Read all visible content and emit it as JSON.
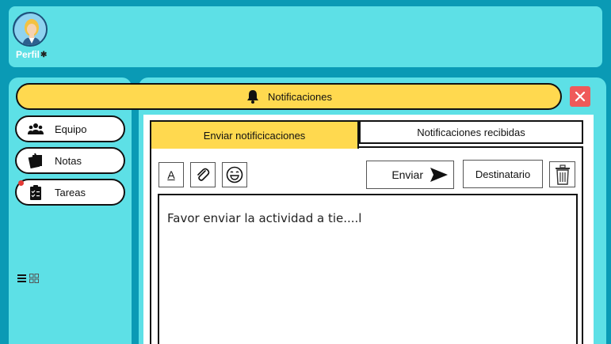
{
  "profile": {
    "label": "Perfil",
    "icon": "gear-icon"
  },
  "notification_bar": {
    "label": "Notificaciones",
    "icon": "bell-icon"
  },
  "sidebar": {
    "items": [
      {
        "label": "Equipo",
        "icon": "team-icon"
      },
      {
        "label": "Notas",
        "icon": "notes-icon"
      },
      {
        "label": "Tareas",
        "icon": "tasks-icon",
        "badge": true
      }
    ]
  },
  "tabs": {
    "send": "Enviar notificicaciones",
    "received": "Notificaciones recibidas"
  },
  "toolbar": {
    "font_label": "A",
    "send_label": "Enviar",
    "recipient_label": "Destinatario"
  },
  "message": {
    "value": "Favor enviar la actividad a tie....l"
  },
  "colors": {
    "accent": "#ffd94f",
    "panel": "#5de0e6",
    "background": "#0a9ab5",
    "close": "#ef5a5a"
  }
}
